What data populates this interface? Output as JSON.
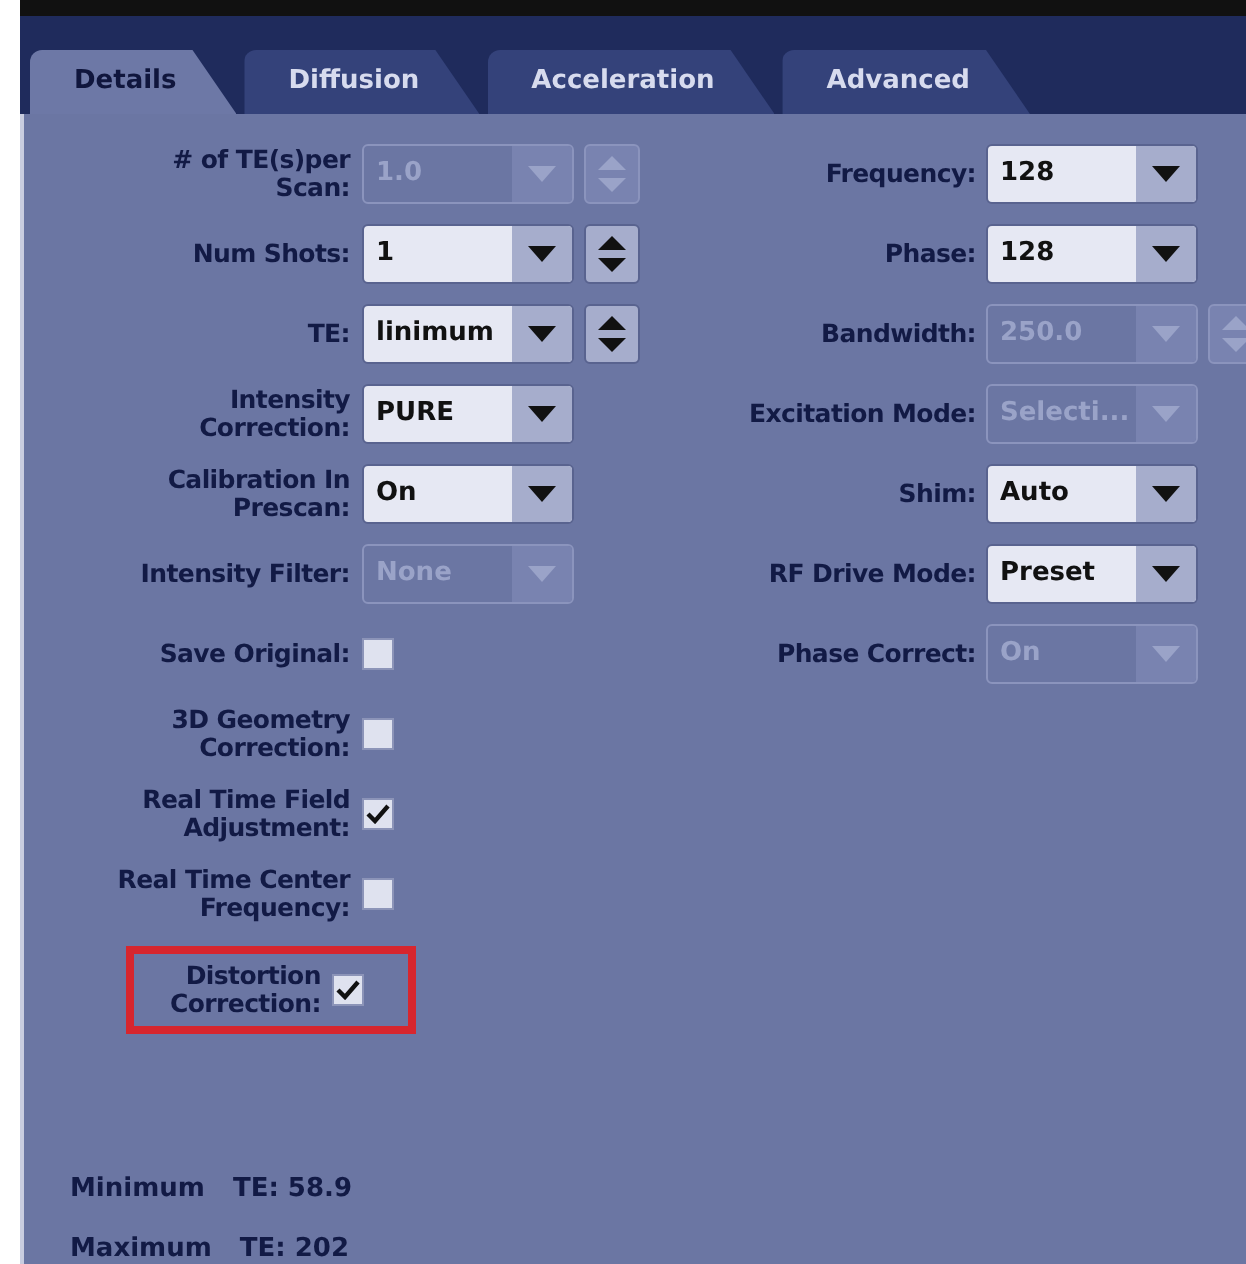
{
  "tabs": [
    {
      "label": "Details",
      "selected": true
    },
    {
      "label": "Diffusion",
      "selected": false
    },
    {
      "label": "Acceleration",
      "selected": false
    },
    {
      "label": "Advanced",
      "selected": false
    }
  ],
  "left_fields": [
    {
      "kind": "combo",
      "label": "# of TE(s)per\nScan:",
      "value": "1.0",
      "disabled": true,
      "spinner": {
        "disabled": true
      }
    },
    {
      "kind": "combo",
      "label": "Num Shots:",
      "value": "1",
      "disabled": false,
      "spinner": {
        "disabled": false
      }
    },
    {
      "kind": "combo",
      "label": "TE:",
      "value": "linimum",
      "disabled": false,
      "spinner": {
        "disabled": false
      }
    },
    {
      "kind": "combo",
      "label": "Intensity\nCorrection:",
      "value": "PURE",
      "disabled": false
    },
    {
      "kind": "combo",
      "label": "Calibration In\nPrescan:",
      "value": "On",
      "disabled": false
    },
    {
      "kind": "combo",
      "label": "Intensity Filter:",
      "value": "None",
      "disabled": true
    },
    {
      "kind": "check",
      "label": "Save Original:",
      "checked": false
    },
    {
      "kind": "check",
      "label": "3D Geometry\nCorrection:",
      "checked": false
    },
    {
      "kind": "check",
      "label": "Real Time Field\nAdjustment:",
      "checked": true
    },
    {
      "kind": "check",
      "label": "Real Time Center\nFrequency:",
      "checked": false
    },
    {
      "kind": "check",
      "label": "Distortion\nCorrection:",
      "checked": true,
      "highlighted": true
    }
  ],
  "right_fields": [
    {
      "kind": "combo",
      "label": "Frequency:",
      "value": "128",
      "disabled": false
    },
    {
      "kind": "combo",
      "label": "Phase:",
      "value": "128",
      "disabled": false
    },
    {
      "kind": "combo",
      "label": "Bandwidth:",
      "value": "250.0",
      "disabled": true,
      "spinner": {
        "disabled": true
      }
    },
    {
      "kind": "combo",
      "label": "Excitation Mode:",
      "value": "Selecti...",
      "disabled": true
    },
    {
      "kind": "combo",
      "label": "Shim:",
      "value": "Auto",
      "disabled": false
    },
    {
      "kind": "combo",
      "label": "RF Drive Mode:",
      "value": "Preset",
      "disabled": false
    },
    {
      "kind": "combo",
      "label": "Phase Correct:",
      "value": "On",
      "disabled": true
    }
  ],
  "footer": [
    {
      "label": "Minimum",
      "value": "TE: 58.9"
    },
    {
      "label": "Maximum",
      "value": "TE: 202"
    }
  ]
}
